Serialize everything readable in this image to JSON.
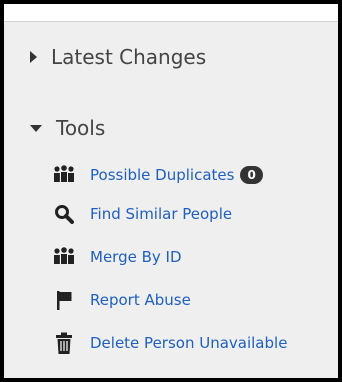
{
  "sections": {
    "latest_changes": {
      "label": "Latest Changes",
      "expanded": false
    },
    "tools": {
      "label": "Tools",
      "expanded": true
    }
  },
  "tools": [
    {
      "label": "Possible Duplicates",
      "icon": "people-group-icon",
      "badge": "0"
    },
    {
      "label": "Find Similar People",
      "icon": "search-icon"
    },
    {
      "label": "Merge By ID",
      "icon": "people-group-icon"
    },
    {
      "label": "Report Abuse",
      "icon": "flag-icon"
    },
    {
      "label": "Delete Person Unavailable",
      "icon": "trash-icon"
    }
  ],
  "colors": {
    "link": "#1f5fbf",
    "panel_bg": "#efefef",
    "heading": "#444444",
    "badge_bg": "#333333"
  }
}
